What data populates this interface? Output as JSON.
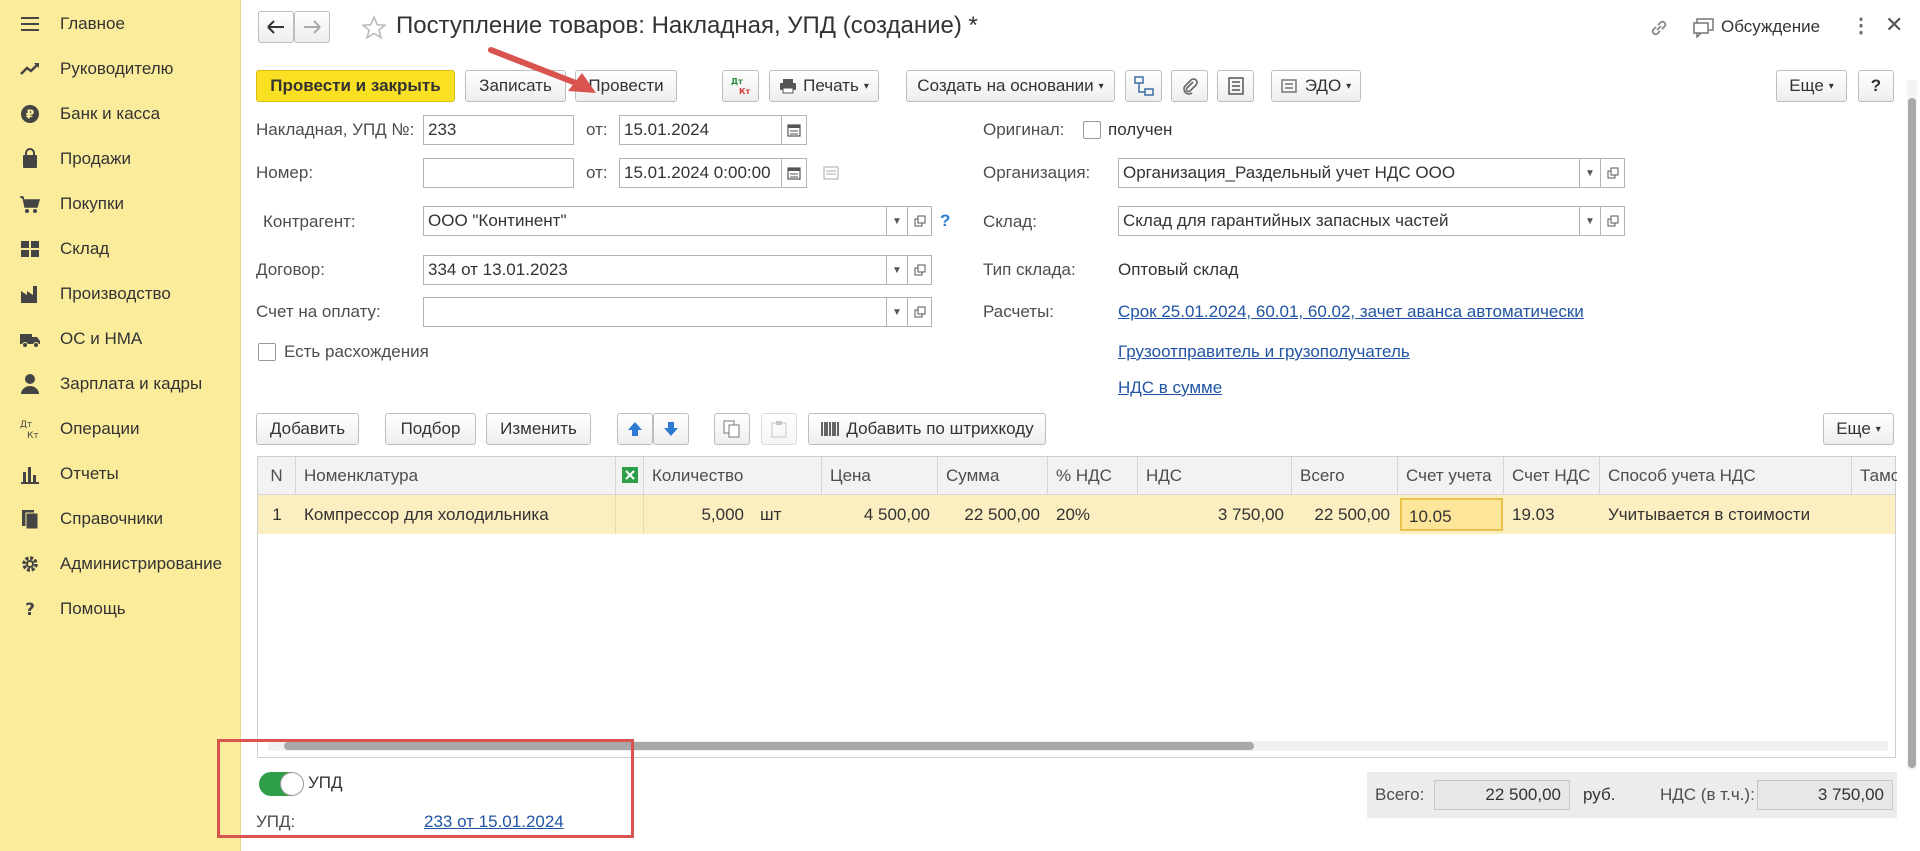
{
  "sidebar": {
    "items": [
      {
        "label": "Главное",
        "icon": "menu-icon"
      },
      {
        "label": "Руководителю",
        "icon": "trend-icon"
      },
      {
        "label": "Банк и касса",
        "icon": "ruble-icon"
      },
      {
        "label": "Продажи",
        "icon": "bag-icon"
      },
      {
        "label": "Покупки",
        "icon": "cart-icon"
      },
      {
        "label": "Склад",
        "icon": "warehouse-icon"
      },
      {
        "label": "Производство",
        "icon": "factory-icon"
      },
      {
        "label": "ОС и НМА",
        "icon": "truck-icon"
      },
      {
        "label": "Зарплата и кадры",
        "icon": "person-icon"
      },
      {
        "label": "Операции",
        "icon": "dt-kt-icon"
      },
      {
        "label": "Отчеты",
        "icon": "bar-chart-icon"
      },
      {
        "label": "Справочники",
        "icon": "books-icon"
      },
      {
        "label": "Администрирование",
        "icon": "gear-icon"
      },
      {
        "label": "Помощь",
        "icon": "question-icon"
      }
    ]
  },
  "header": {
    "title": "Поступление товаров: Накладная, УПД (создание) *",
    "discussion": "Обсуждение"
  },
  "toolbar": {
    "post_close": "Провести и закрыть",
    "save": "Записать",
    "post": "Провести",
    "dtkt": "Дт Кт",
    "print": "Печать",
    "create_based": "Создать на основании",
    "edo": "ЭДО",
    "more": "Еще",
    "help": "?"
  },
  "form": {
    "invoice_label": "Накладная, УПД №:",
    "invoice_no": "233",
    "from_label": "от:",
    "invoice_date": "15.01.2024",
    "number_label": "Номер:",
    "number_value": "",
    "number_date": "15.01.2024  0:00:00",
    "original_label": "Оригинал:",
    "original_checkbox": "получен",
    "org_label": "Организация:",
    "org_value": "Организация_Раздельный учет НДС ООО",
    "counterparty_label": "Контрагент:",
    "counterparty_value": "ООО \"Континент\"",
    "warehouse_label": "Склад:",
    "warehouse_value": "Склад для гарантийных запасных частей",
    "contract_label": "Договор:",
    "contract_value": "334 от 13.01.2023",
    "wh_type_label": "Тип склада:",
    "wh_type_value": "Оптовый склад",
    "payment_label": "Счет на оплату:",
    "payment_value": "",
    "settlements_label": "Расчеты:",
    "settlements_link": "Срок 25.01.2024, 60.01, 60.02, зачет аванса автоматически",
    "discrepancy": "Есть расхождения",
    "shipper_link": "Грузоотправитель и грузополучатель",
    "vat_link": "НДС в сумме"
  },
  "table_toolbar": {
    "add": "Добавить",
    "pick": "Подбор",
    "change": "Изменить",
    "barcode": "Добавить по штрихкоду",
    "more": "Еще"
  },
  "table": {
    "columns": [
      "N",
      "Номенклатура",
      "Количество",
      "Цена",
      "Сумма",
      "% НДС",
      "НДС",
      "Всего",
      "Счет учета",
      "Счет НДС",
      "Способ учета НДС",
      "Тамо"
    ],
    "rows": [
      {
        "n": "1",
        "name": "Компрессор для холодильника",
        "qty": "5,000",
        "unit": "шт",
        "price": "4 500,00",
        "sum": "22 500,00",
        "vat_rate": "20%",
        "vat": "3 750,00",
        "total": "22 500,00",
        "account": "10.05",
        "vat_account": "19.03",
        "vat_method": "Учитывается в стоимости"
      }
    ]
  },
  "footer": {
    "upd_toggle": "УПД",
    "upd_label": "УПД:",
    "upd_link": "233 от 15.01.2024",
    "total_label": "Всего:",
    "total_value": "22 500,00",
    "currency": "руб.",
    "vat_label": "НДС (в т.ч.):",
    "vat_value": "3 750,00"
  },
  "colors": {
    "sidebar_bg": "#fbec9c",
    "primary_button": "#f9e023",
    "link": "#2155a4",
    "annotation_red": "#d9534f",
    "row_highlight": "#fbeec0",
    "toggle_green": "#2e9e48"
  }
}
